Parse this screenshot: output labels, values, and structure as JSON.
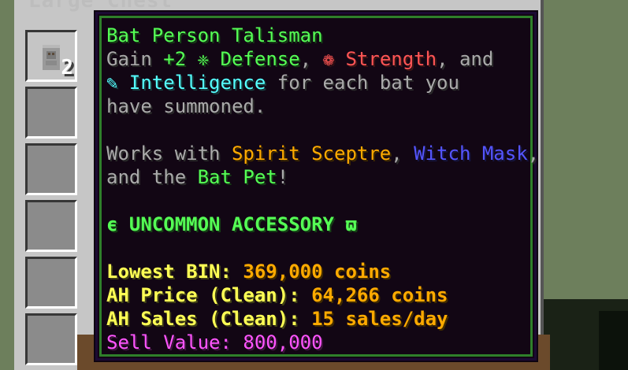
{
  "container_title": "Large Chest",
  "slot_item": {
    "count": "2",
    "icon": "bat-person-talisman-icon"
  },
  "tooltip": {
    "name": "Bat Person Talisman",
    "desc_line1": {
      "gain": "Gain",
      "amount": "+2",
      "defense_icon": "❈",
      "defense": "Defense",
      "strength_icon": "❁",
      "strength": "Strength",
      "and": ", and"
    },
    "desc_line2": {
      "intel_icon": "✎",
      "intelligence": "Intelligence",
      "rest": "for each bat you"
    },
    "desc_line3": "have summoned.",
    "works_line1": {
      "prefix": "Works with",
      "spirit": "Spirit Sceptre",
      "comma": ",",
      "witch": "Witch Mask",
      "comma2": ","
    },
    "works_line2": {
      "prefix": "and the",
      "bat_pet": "Bat Pet",
      "suffix": "!"
    },
    "rarity": "ϵ UNCOMMON ACCESSORY ϖ",
    "lowest_bin": {
      "label": "Lowest BIN:",
      "value": "369,000 coins"
    },
    "ah_price": {
      "label": "AH Price (Clean):",
      "value": "64,266 coins"
    },
    "ah_sales": {
      "label": "AH Sales (Clean):",
      "value": "15 sales/day"
    },
    "sell_value": {
      "label": "Sell Value:",
      "value": "800,000"
    }
  },
  "colors": {
    "green": "#55ff55",
    "red": "#ff5555",
    "aqua": "#55ffff",
    "gold": "#ffaa00",
    "blue": "#5555ff",
    "yellow": "#ffff55",
    "pink": "#ff55ff",
    "gray": "#aaaaaa",
    "tooltip_bg": "#120614",
    "tooltip_border": "#2f7f2a"
  }
}
